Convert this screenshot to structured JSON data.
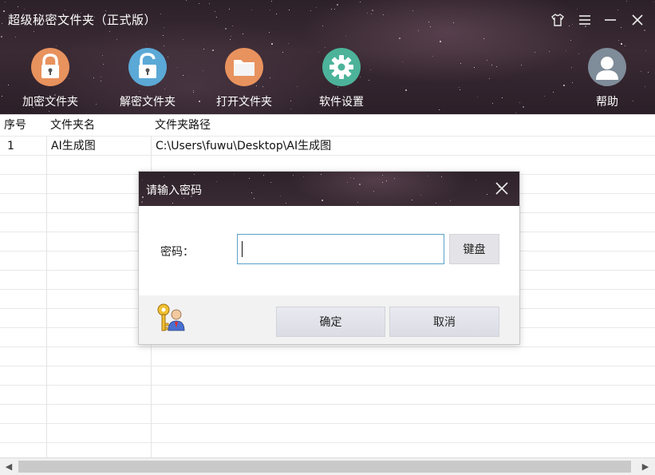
{
  "app": {
    "title": "超级秘密文件夹（正式版）"
  },
  "window_controls": {
    "skin": "shirt-icon",
    "menu": "menu-icon",
    "minimize": "minimize-icon",
    "close": "close-icon"
  },
  "toolbar": {
    "items": [
      {
        "label": "加密文件夹",
        "icon": "lock-icon",
        "color": "#e8925e"
      },
      {
        "label": "解密文件夹",
        "icon": "unlock-icon",
        "color": "#5ba9d6"
      },
      {
        "label": "打开文件夹",
        "icon": "folder-icon",
        "color": "#e8925e"
      },
      {
        "label": "软件设置",
        "icon": "gear-icon",
        "color": "#4cb39a"
      }
    ],
    "help": {
      "label": "帮助",
      "icon": "user-icon",
      "color": "#7f8c99"
    }
  },
  "table": {
    "headers": [
      "序号",
      "文件夹名",
      "文件夹路径"
    ],
    "rows": [
      [
        "1",
        "AI生成图",
        "C:\\Users\\fuwu\\Desktop\\AI生成图"
      ]
    ]
  },
  "dialog": {
    "title": "请输入密码",
    "password_label": "密码：",
    "password_value": "",
    "keyboard_label": "键盘",
    "ok_label": "确定",
    "cancel_label": "取消"
  },
  "colors": {
    "header_bg": "#2d2129",
    "input_border": "#5aa0c8",
    "button_bg": "#e3e3e8"
  }
}
